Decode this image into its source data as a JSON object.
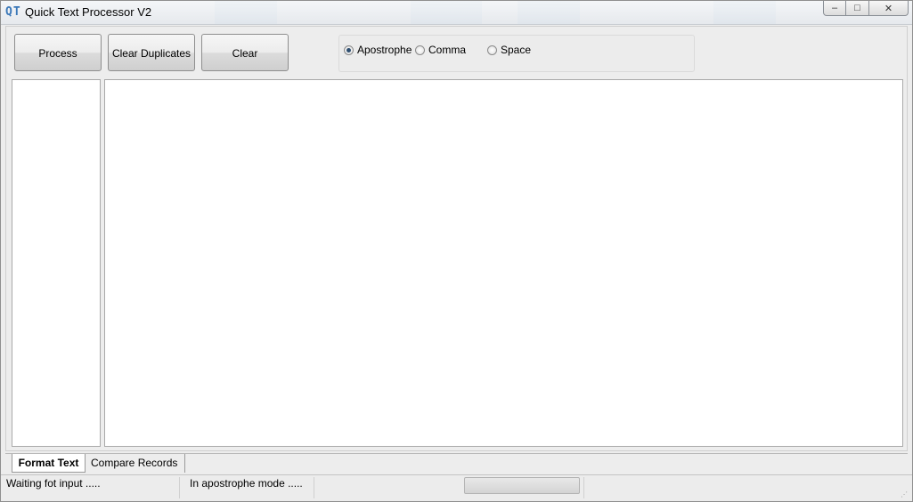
{
  "window": {
    "icon_text": "QT",
    "title": "Quick Text Processor V2",
    "controls": {
      "minimize_glyph": "–",
      "maximize_glyph": "□",
      "close_glyph": "✕"
    }
  },
  "toolbar": {
    "process_label": "Process",
    "clear_duplicates_label": "Clear Duplicates",
    "clear_label": "Clear"
  },
  "delimiter": {
    "options": [
      {
        "label": "Apostrophe",
        "checked": true
      },
      {
        "label": "Comma",
        "checked": false
      },
      {
        "label": "Space",
        "checked": false
      }
    ]
  },
  "tabs": [
    {
      "label": "Format Text",
      "active": true
    },
    {
      "label": "Compare Records",
      "active": false
    }
  ],
  "status": {
    "input_status": "Waiting fot input .....",
    "mode_status": "In apostrophe mode .....",
    "progress": 0
  },
  "colors": {
    "radio_checked": "#2e4e70",
    "icon_accent": "#3b78b8"
  }
}
